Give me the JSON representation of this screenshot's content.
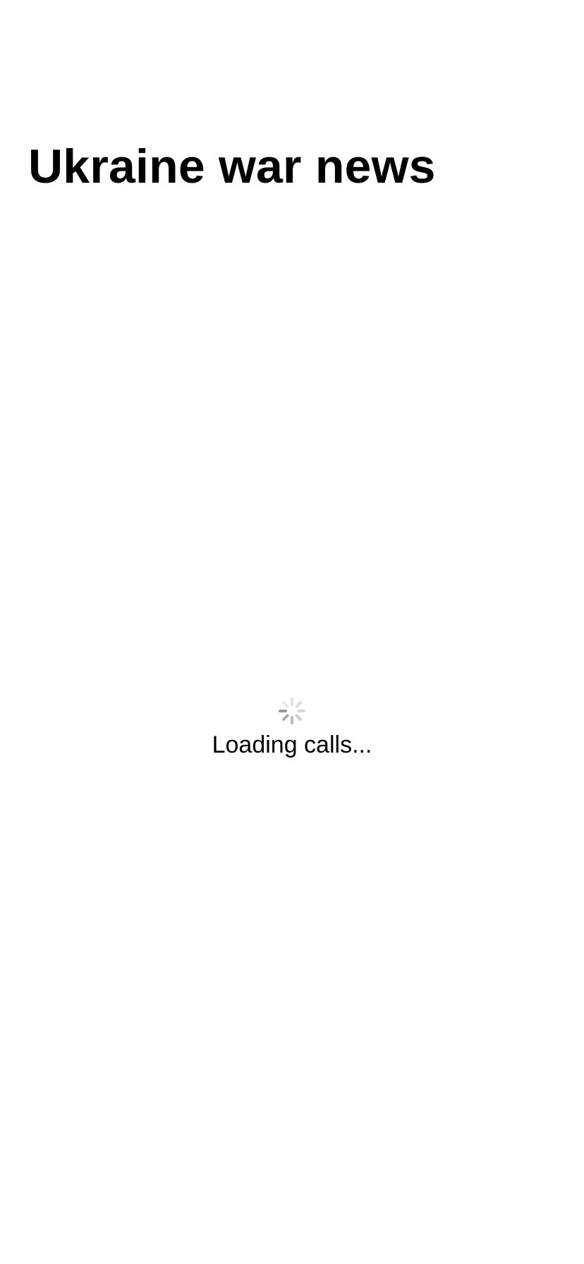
{
  "header": {
    "title": "Ukraine war news"
  },
  "loading": {
    "icon": "spinner-icon",
    "text": "Loading calls..."
  },
  "colors": {
    "background": "#ffffff",
    "text": "#000000",
    "spinner": "#8e8e93"
  }
}
